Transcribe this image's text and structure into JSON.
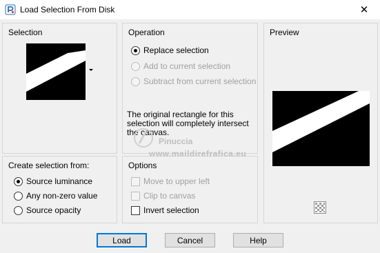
{
  "window": {
    "title": "Load Selection From Disk",
    "close_glyph": "✕"
  },
  "selection": {
    "title": "Selection"
  },
  "operation": {
    "title": "Operation",
    "options": [
      "Replace selection",
      "Add to current selection",
      "Subtract from current selection"
    ],
    "selected": "Replace selection",
    "info": "The original rectangle for this selection will completely intersect the canvas."
  },
  "preview": {
    "title": "Preview"
  },
  "create_from": {
    "title": "Create selection from:",
    "options": [
      "Source luminance",
      "Any non-zero value",
      "Source opacity"
    ],
    "selected": "Source luminance"
  },
  "options": {
    "title": "Options",
    "move_to_upper_left": "Move to upper left",
    "clip_to_canvas": "Clip to canvas",
    "invert_selection": "Invert selection"
  },
  "buttons": {
    "load": "Load",
    "cancel": "Cancel",
    "help": "Help"
  },
  "watermark": {
    "name": "Pinuccia",
    "url": "www.maildirefrafica.eu"
  }
}
